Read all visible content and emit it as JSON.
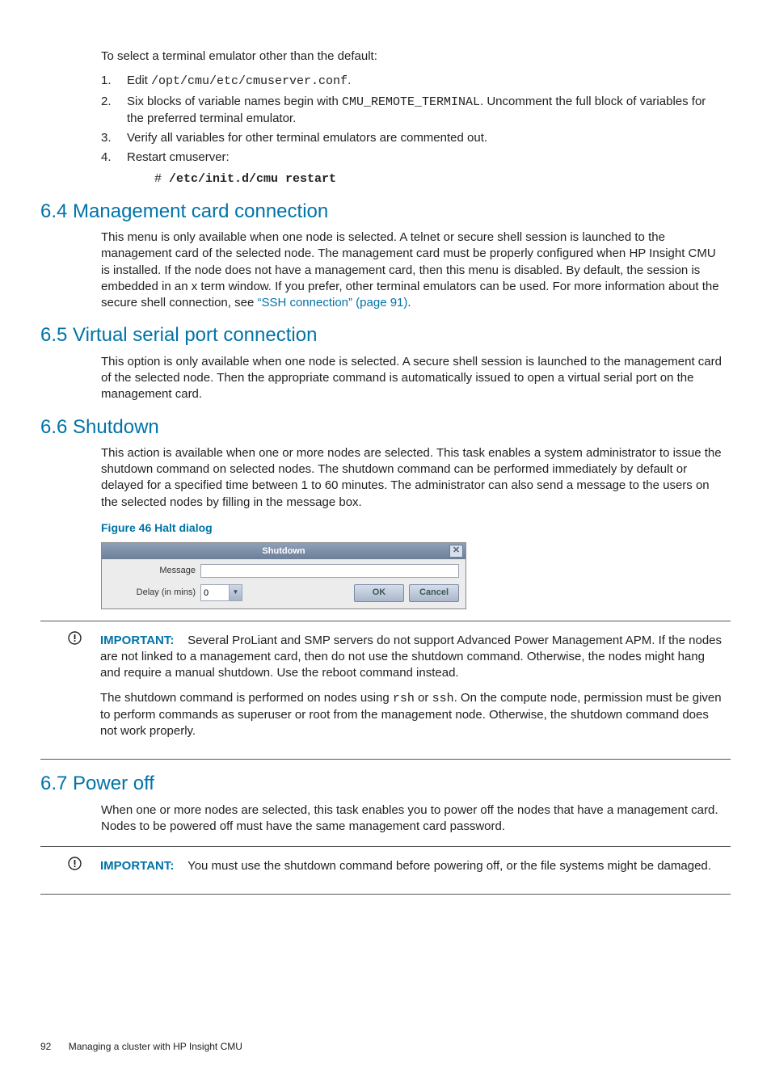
{
  "intro": {
    "lead": "To select a terminal emulator other than the default:",
    "step1_a": "Edit ",
    "step1_code": "/opt/cmu/etc/cmuserver.conf",
    "step1_b": ".",
    "step2_a": "Six blocks of variable names begin with ",
    "step2_code": "CMU_REMOTE_TERMINAL",
    "step2_b": ". Uncomment the full block of variables for the preferred terminal emulator.",
    "step3": "Verify all variables for other terminal emulators are commented out.",
    "step4": "Restart cmuserver:",
    "cmd_prompt": "# ",
    "cmd": "/etc/init.d/cmu restart"
  },
  "s64": {
    "title": "6.4 Management card connection",
    "body_a": "This menu is only available when one node is selected. A telnet or secure shell session is launched to the management card of the selected node. The management card must be properly configured when HP Insight CMU is installed. If the node does not have a management card, then this menu is disabled. By default, the session is embedded in an x term window. If you prefer, other terminal emulators can be used. For more information about the secure shell connection, see ",
    "link": "“SSH connection” (page 91)",
    "body_b": "."
  },
  "s65": {
    "title": "6.5 Virtual serial port connection",
    "body": "This option is only available when one node is selected. A secure shell session is launched to the management card of the selected node. Then the appropriate command is automatically issued to open a virtual serial port on the management card."
  },
  "s66": {
    "title": "6.6 Shutdown",
    "body": "This action is available when one or more nodes are selected. This task enables a system administrator to issue the shutdown command on selected nodes. The shutdown command can be performed immediately by default or delayed for a specified time between 1 to 60 minutes. The administrator can also send a message to the users on the selected nodes by filling in the message box.",
    "fig_caption": "Figure 46 Halt dialog"
  },
  "dialog": {
    "title": "Shutdown",
    "message_label": "Message",
    "delay_label": "Delay (in mins)",
    "delay_value": "0",
    "ok": "OK",
    "cancel": "Cancel"
  },
  "imp1": {
    "label": "IMPORTANT:",
    "p1": "Several ProLiant and SMP servers do not support Advanced Power Management APM. If the nodes are not linked to a management card, then do not use the shutdown command. Otherwise, the nodes might hang and require a manual shutdown. Use the reboot command instead.",
    "p2a": "The shutdown command is performed on nodes using ",
    "p2code1": "rsh",
    "p2mid": " or ",
    "p2code2": "ssh",
    "p2b": ". On the compute node, permission must be given to perform commands as superuser or root from the management node. Otherwise, the shutdown command does not work properly."
  },
  "s67": {
    "title": "6.7 Power off",
    "body": "When one or more nodes are selected, this task enables you to power off the nodes that have a management card. Nodes to be powered off must have the same management card password."
  },
  "imp2": {
    "label": "IMPORTANT:",
    "body": "You must use the shutdown command before powering off, or the file systems might be damaged."
  },
  "footer": {
    "page": "92",
    "title": "Managing a cluster with HP Insight CMU"
  }
}
